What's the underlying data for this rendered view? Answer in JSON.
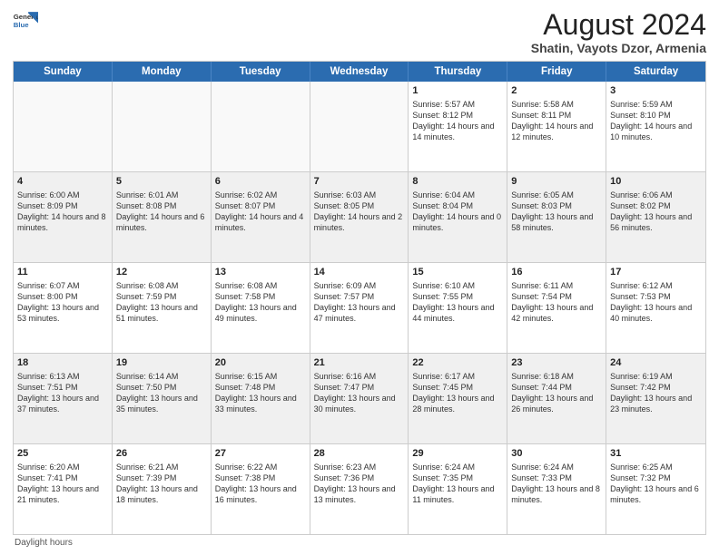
{
  "header": {
    "logo_general": "General",
    "logo_blue": "Blue",
    "title": "August 2024",
    "location": "Shatin, Vayots Dzor, Armenia"
  },
  "calendar": {
    "days_of_week": [
      "Sunday",
      "Monday",
      "Tuesday",
      "Wednesday",
      "Thursday",
      "Friday",
      "Saturday"
    ],
    "weeks": [
      [
        {
          "day": "",
          "info": ""
        },
        {
          "day": "",
          "info": ""
        },
        {
          "day": "",
          "info": ""
        },
        {
          "day": "",
          "info": ""
        },
        {
          "day": "1",
          "info": "Sunrise: 5:57 AM\nSunset: 8:12 PM\nDaylight: 14 hours and 14 minutes."
        },
        {
          "day": "2",
          "info": "Sunrise: 5:58 AM\nSunset: 8:11 PM\nDaylight: 14 hours and 12 minutes."
        },
        {
          "day": "3",
          "info": "Sunrise: 5:59 AM\nSunset: 8:10 PM\nDaylight: 14 hours and 10 minutes."
        }
      ],
      [
        {
          "day": "4",
          "info": "Sunrise: 6:00 AM\nSunset: 8:09 PM\nDaylight: 14 hours and 8 minutes."
        },
        {
          "day": "5",
          "info": "Sunrise: 6:01 AM\nSunset: 8:08 PM\nDaylight: 14 hours and 6 minutes."
        },
        {
          "day": "6",
          "info": "Sunrise: 6:02 AM\nSunset: 8:07 PM\nDaylight: 14 hours and 4 minutes."
        },
        {
          "day": "7",
          "info": "Sunrise: 6:03 AM\nSunset: 8:05 PM\nDaylight: 14 hours and 2 minutes."
        },
        {
          "day": "8",
          "info": "Sunrise: 6:04 AM\nSunset: 8:04 PM\nDaylight: 14 hours and 0 minutes."
        },
        {
          "day": "9",
          "info": "Sunrise: 6:05 AM\nSunset: 8:03 PM\nDaylight: 13 hours and 58 minutes."
        },
        {
          "day": "10",
          "info": "Sunrise: 6:06 AM\nSunset: 8:02 PM\nDaylight: 13 hours and 56 minutes."
        }
      ],
      [
        {
          "day": "11",
          "info": "Sunrise: 6:07 AM\nSunset: 8:00 PM\nDaylight: 13 hours and 53 minutes."
        },
        {
          "day": "12",
          "info": "Sunrise: 6:08 AM\nSunset: 7:59 PM\nDaylight: 13 hours and 51 minutes."
        },
        {
          "day": "13",
          "info": "Sunrise: 6:08 AM\nSunset: 7:58 PM\nDaylight: 13 hours and 49 minutes."
        },
        {
          "day": "14",
          "info": "Sunrise: 6:09 AM\nSunset: 7:57 PM\nDaylight: 13 hours and 47 minutes."
        },
        {
          "day": "15",
          "info": "Sunrise: 6:10 AM\nSunset: 7:55 PM\nDaylight: 13 hours and 44 minutes."
        },
        {
          "day": "16",
          "info": "Sunrise: 6:11 AM\nSunset: 7:54 PM\nDaylight: 13 hours and 42 minutes."
        },
        {
          "day": "17",
          "info": "Sunrise: 6:12 AM\nSunset: 7:53 PM\nDaylight: 13 hours and 40 minutes."
        }
      ],
      [
        {
          "day": "18",
          "info": "Sunrise: 6:13 AM\nSunset: 7:51 PM\nDaylight: 13 hours and 37 minutes."
        },
        {
          "day": "19",
          "info": "Sunrise: 6:14 AM\nSunset: 7:50 PM\nDaylight: 13 hours and 35 minutes."
        },
        {
          "day": "20",
          "info": "Sunrise: 6:15 AM\nSunset: 7:48 PM\nDaylight: 13 hours and 33 minutes."
        },
        {
          "day": "21",
          "info": "Sunrise: 6:16 AM\nSunset: 7:47 PM\nDaylight: 13 hours and 30 minutes."
        },
        {
          "day": "22",
          "info": "Sunrise: 6:17 AM\nSunset: 7:45 PM\nDaylight: 13 hours and 28 minutes."
        },
        {
          "day": "23",
          "info": "Sunrise: 6:18 AM\nSunset: 7:44 PM\nDaylight: 13 hours and 26 minutes."
        },
        {
          "day": "24",
          "info": "Sunrise: 6:19 AM\nSunset: 7:42 PM\nDaylight: 13 hours and 23 minutes."
        }
      ],
      [
        {
          "day": "25",
          "info": "Sunrise: 6:20 AM\nSunset: 7:41 PM\nDaylight: 13 hours and 21 minutes."
        },
        {
          "day": "26",
          "info": "Sunrise: 6:21 AM\nSunset: 7:39 PM\nDaylight: 13 hours and 18 minutes."
        },
        {
          "day": "27",
          "info": "Sunrise: 6:22 AM\nSunset: 7:38 PM\nDaylight: 13 hours and 16 minutes."
        },
        {
          "day": "28",
          "info": "Sunrise: 6:23 AM\nSunset: 7:36 PM\nDaylight: 13 hours and 13 minutes."
        },
        {
          "day": "29",
          "info": "Sunrise: 6:24 AM\nSunset: 7:35 PM\nDaylight: 13 hours and 11 minutes."
        },
        {
          "day": "30",
          "info": "Sunrise: 6:24 AM\nSunset: 7:33 PM\nDaylight: 13 hours and 8 minutes."
        },
        {
          "day": "31",
          "info": "Sunrise: 6:25 AM\nSunset: 7:32 PM\nDaylight: 13 hours and 6 minutes."
        }
      ]
    ],
    "footer": "Daylight hours"
  }
}
